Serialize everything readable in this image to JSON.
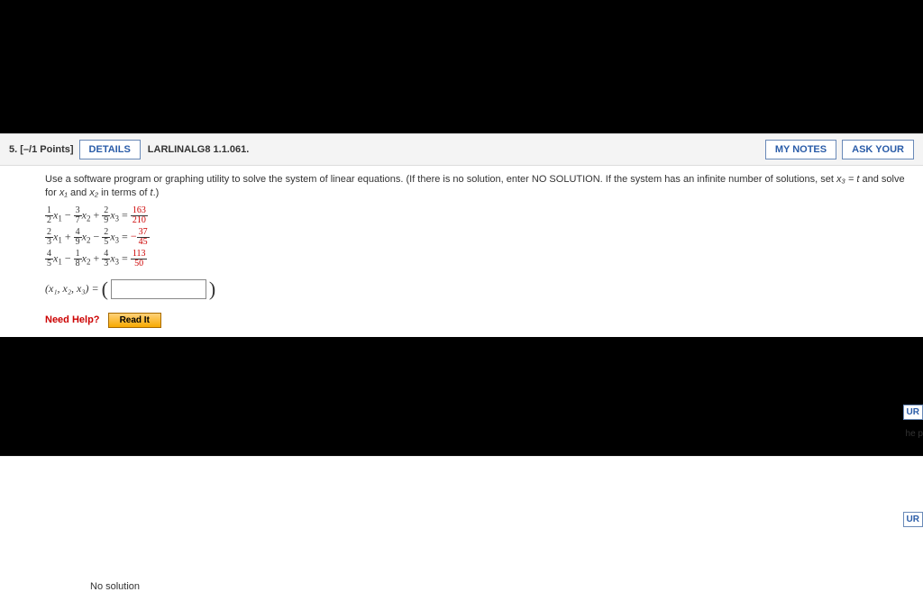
{
  "header": {
    "number": "5.",
    "points": "[–/1 Points]",
    "details": "DETAILS",
    "ref": "LARLINALG8 1.1.061.",
    "notes": "MY NOTES",
    "ask": "ASK YOUR"
  },
  "instr": {
    "part1": "Use a software program or graphing utility to solve the system of linear equations. (If there is no solution, enter NO SOLUTION. If the system has an infinite number of solutions, set ",
    "subst": "x₃ = t",
    "part2": " and solve for ",
    "x1": "x₁",
    "and": " and ",
    "x2": "x₂",
    "part3": " in terms of ",
    "t": "t",
    "end": ".)"
  },
  "eq": [
    {
      "a": {
        "n": "1",
        "d": "2"
      },
      "s1": "−",
      "b": {
        "n": "3",
        "d": "7"
      },
      "s2": "+",
      "c": {
        "n": "2",
        "d": "9"
      },
      "eq": "=",
      "r": {
        "n": "163",
        "d": "210"
      },
      "rsign": ""
    },
    {
      "a": {
        "n": "2",
        "d": "3"
      },
      "s1": "+",
      "b": {
        "n": "4",
        "d": "9"
      },
      "s2": "−",
      "c": {
        "n": "2",
        "d": "5"
      },
      "eq": "=",
      "r": {
        "n": "37",
        "d": "45"
      },
      "rsign": "−"
    },
    {
      "a": {
        "n": "4",
        "d": "5"
      },
      "s1": "−",
      "b": {
        "n": "1",
        "d": "8"
      },
      "s2": "+",
      "c": {
        "n": "4",
        "d": "3"
      },
      "eq": "=",
      "r": {
        "n": "113",
        "d": "50"
      },
      "rsign": ""
    }
  ],
  "vars": {
    "x1": "x",
    "x2": "x",
    "x3": "x",
    "s1": "1",
    "s2": "2",
    "s3": "3"
  },
  "answer": {
    "label": "(x₁, x₂, x₃) = "
  },
  "help": {
    "label": "Need Help?",
    "read": "Read It"
  },
  "side": {
    "ur": "UR",
    "hep": "he p"
  },
  "bottom": {
    "nosol": "No solution"
  }
}
